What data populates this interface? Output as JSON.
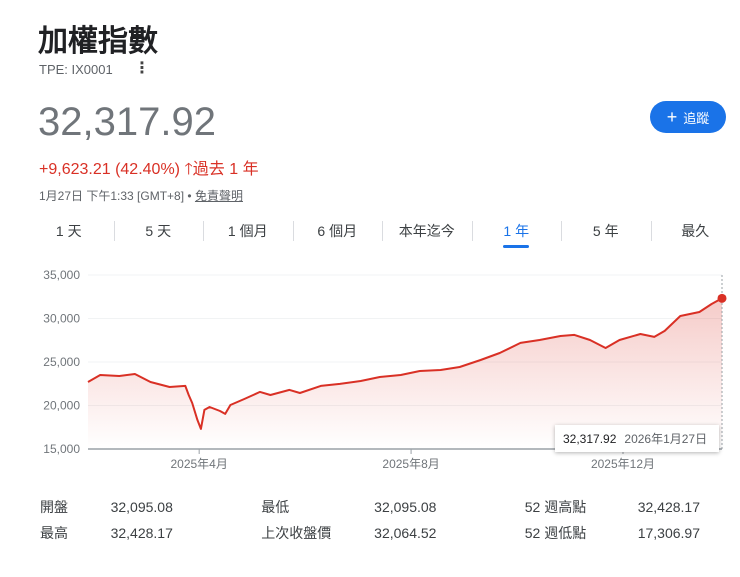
{
  "header": {
    "title": "加權指數",
    "ticker": "TPE: IX0001",
    "more_icon": "⋮",
    "follow_label": "追蹤",
    "follow_icon": "+"
  },
  "quote": {
    "price": "32,317.92",
    "change": "+9,623.21 (42.40%)",
    "change_icon": "arrow-up",
    "period": "過去 1 年",
    "time": "1月27日 下午1:33 [GMT+8]",
    "separator": "•",
    "disclaimer": "免責聲明"
  },
  "tabs": [
    {
      "label": "1 天"
    },
    {
      "label": "5 天"
    },
    {
      "label": "1 個月"
    },
    {
      "label": "6 個月"
    },
    {
      "label": "本年迄今"
    },
    {
      "label": "1 年",
      "active": true
    },
    {
      "label": "5 年"
    },
    {
      "label": "最久"
    }
  ],
  "colors": {
    "line": "#d93025",
    "accent": "#1a73e8"
  },
  "tooltip": {
    "value": "32,317.92",
    "date": "2026年1月27日"
  },
  "chart_data": {
    "type": "area",
    "title": "",
    "xlabel": "",
    "ylabel": "",
    "ylim": [
      15000,
      35000
    ],
    "xlim_days": [
      0,
      365
    ],
    "yticks": [
      "35,000",
      "30,000",
      "25,000",
      "20,000",
      "15,000"
    ],
    "ytick_values": [
      35000,
      30000,
      25000,
      20000,
      15000
    ],
    "xticks": [
      {
        "label": "2025年4月",
        "day": 64
      },
      {
        "label": "2025年8月",
        "day": 186
      },
      {
        "label": "2025年12月",
        "day": 308
      }
    ],
    "x_days": [
      0,
      7,
      18,
      27,
      36,
      47,
      56,
      58,
      60,
      63,
      65,
      67,
      70,
      76,
      79,
      82,
      90,
      99,
      105,
      116,
      122,
      134,
      145,
      157,
      168,
      180,
      191,
      203,
      214,
      226,
      237,
      249,
      260,
      272,
      280,
      289,
      298,
      306,
      318,
      326,
      332,
      341,
      352,
      359,
      365
    ],
    "values": [
      22700,
      23510,
      23390,
      23620,
      22700,
      22130,
      22250,
      21210,
      20290,
      18340,
      17307,
      19490,
      19830,
      19370,
      19030,
      20060,
      20750,
      21560,
      21210,
      21790,
      21440,
      22250,
      22480,
      22820,
      23280,
      23510,
      23970,
      24080,
      24430,
      25230,
      26040,
      27190,
      27530,
      27990,
      28110,
      27530,
      26610,
      27530,
      28220,
      27880,
      28570,
      30290,
      30750,
      31670,
      32318
    ]
  },
  "stats": [
    [
      {
        "label": "開盤",
        "value": "32,095.08"
      },
      {
        "label": "最低",
        "value": "32,095.08"
      },
      {
        "label": "52 週高點",
        "value": "32,428.17"
      }
    ],
    [
      {
        "label": "最高",
        "value": "32,428.17"
      },
      {
        "label": "上次收盤價",
        "value": "32,064.52"
      },
      {
        "label": "52 週低點",
        "value": "17,306.97"
      }
    ]
  ]
}
